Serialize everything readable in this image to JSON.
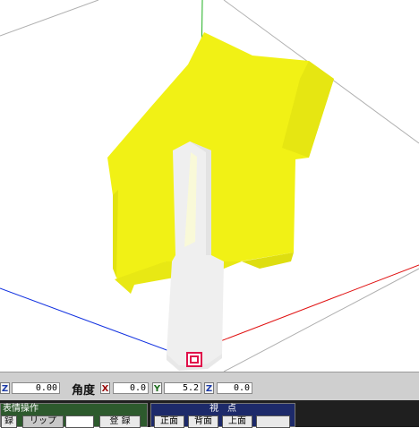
{
  "coord_bar": {
    "z_axis_label": "Z",
    "z_value": "0.00",
    "angle_label": "角度",
    "angle": {
      "x_label": "X",
      "x_value": "0.0",
      "y_label": "Y",
      "y_value": "5.2",
      "z_label": "Z",
      "z_value": "0.0"
    }
  },
  "expression_panel": {
    "title": "表情操作",
    "left_button": "録",
    "middle_button": "リップ",
    "register_button": "登 録"
  },
  "view_panel": {
    "title": "視　点",
    "front_button": "正面",
    "back_button": "背面",
    "top_button": "上面"
  },
  "colors": {
    "model_yellow": "#f1f115",
    "model_white": "#f0f0f0",
    "axis_x": "#e01010",
    "axis_y": "#20b020",
    "axis_z": "#1030e0",
    "expression_panel_bg": "#2d5a2d",
    "view_panel_bg": "#1d2a6a",
    "selection_marker": "#e0104a"
  },
  "icons": {
    "bone_marker": "selected-bone-icon"
  }
}
